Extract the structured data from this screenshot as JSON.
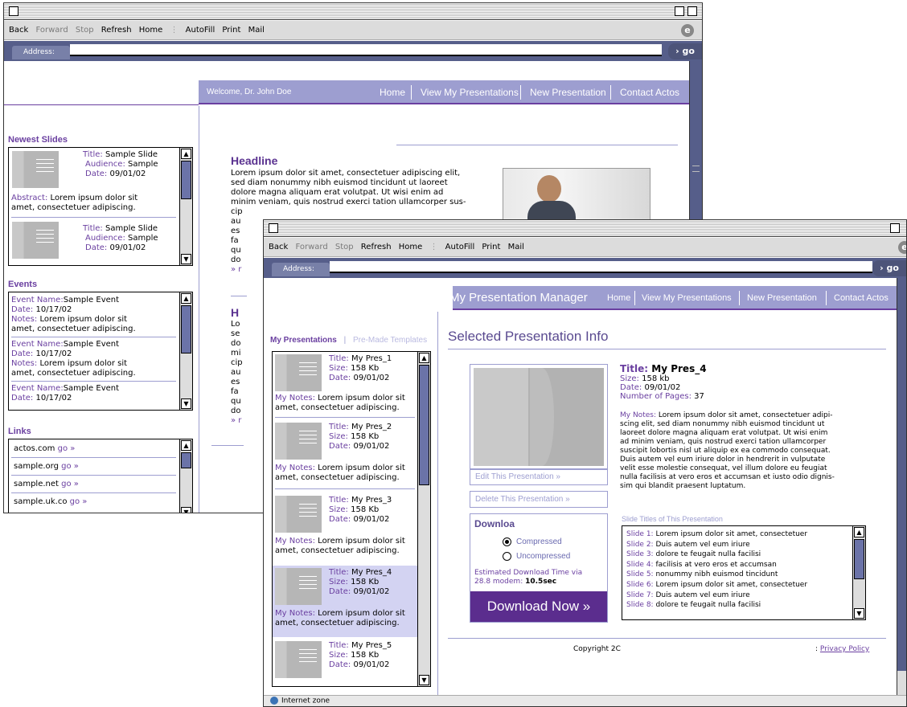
{
  "toolbar": {
    "back": "Back",
    "forward": "Forward",
    "stop": "Stop",
    "refresh": "Refresh",
    "home": "Home",
    "autofill": "AutoFill",
    "print": "Print",
    "mail": "Mail"
  },
  "address": {
    "label": "Address:",
    "go": "go",
    "logo": "e"
  },
  "nav": {
    "home": "Home",
    "view": "View My Presentations",
    "new": "New Presentation",
    "contact": "Contact Actos"
  },
  "w1": {
    "welcome": "Welcome, Dr. John Doe",
    "newest_title": "Newest Slides",
    "slides": [
      {
        "title_l": "Title:",
        "title": "Sample Slide",
        "aud_l": "Audience:",
        "aud": "Sample",
        "date_l": "Date:",
        "date": "09/01/02",
        "abs_l": "Abstract:",
        "abs1": "Lorem ipsum dolor sit",
        "abs2": "amet, consectetuer adipiscing."
      },
      {
        "title_l": "Title:",
        "title": "Sample Slide",
        "aud_l": "Audience:",
        "aud": "Sample",
        "date_l": "Date:",
        "date": "09/01/02"
      }
    ],
    "events_title": "Events",
    "events": [
      {
        "name_l": "Event Name:",
        "name": "Sample Event",
        "date_l": "Date:",
        "date": "10/17/02",
        "notes_l": "Notes:",
        "notes1": "Lorem ipsum dolor sit",
        "notes2": "amet, consectetuer adipiscing."
      },
      {
        "name_l": "Event Name:",
        "name": "Sample Event",
        "date_l": "Date:",
        "date": "10/17/02",
        "notes_l": "Notes:",
        "notes1": "Lorem ipsum dolor sit",
        "notes2": "amet, consectetuer adipiscing."
      },
      {
        "name_l": "Event Name:",
        "name": "Sample Event",
        "date_l": "Date:",
        "date": "10/17/02"
      }
    ],
    "links_title": "Links",
    "links": [
      {
        "site": "actos.com",
        "go": "go »"
      },
      {
        "site": "sample.org",
        "go": "go »"
      },
      {
        "site": "sample.net",
        "go": "go »"
      },
      {
        "site": "sample.uk.co",
        "go": "go »"
      }
    ],
    "headline": "Headline",
    "body": [
      "Lorem ipsum dolor sit amet, consectetuer adipiscing elit,",
      "sed diam nonummy nibh euismod tincidunt ut laoreet",
      "dolore magna aliquam erat volutpat. Ut wisi enim ad",
      "minim veniam, quis nostrud exerci tation ullamcorper sus-",
      "cip",
      "au",
      "es",
      "fa",
      "qu",
      "do",
      "» r"
    ],
    "headline2": "H",
    "body2": [
      "Lo",
      "se",
      "do",
      "mi",
      "cip",
      "au",
      "es",
      "fa",
      "qu",
      "do",
      "» r"
    ]
  },
  "w2": {
    "nav_title": "My Presentation Manager",
    "tab_my": "My Presentations",
    "tab_sep": "|",
    "tab_pre": "Pre-Made Templates",
    "presentations": [
      {
        "title": "My Pres_1",
        "size": "158 Kb",
        "date": "09/01/02"
      },
      {
        "title": "My Pres_2",
        "size": "158 Kb",
        "date": "09/01/02"
      },
      {
        "title": "My Pres_3",
        "size": "158 Kb",
        "date": "09/01/02"
      },
      {
        "title": "My Pres_4",
        "size": "158 Kb",
        "date": "09/01/02"
      },
      {
        "title": "My Pres_5",
        "size": "158 Kb",
        "date": "09/01/02"
      }
    ],
    "labels": {
      "title": "Title:",
      "size": "Size:",
      "date": "Date:",
      "notes": "My Notes:",
      "pages": "Number of Pages:"
    },
    "notes1": "Lorem ipsum dolor sit",
    "notes2": "amet, consectetuer adipiscing.",
    "selected_heading": "Selected Presentation Info",
    "sel": {
      "title": "My Pres_4",
      "size_l": "Size:",
      "size": "158 kb",
      "date": "09/01/02",
      "pages": "37"
    },
    "sel_notes": [
      "Lorem ipsum dolor sit amet, consectetuer adipi-",
      "scing elit, sed diam nonummy nibh euismod tincidunt ut",
      "laoreet dolore magna aliquam erat volutpat. Ut wisi enim",
      "ad minim veniam, quis nostrud exerci tation ullamcorper",
      "suscipit lobortis nisl ut aliquip ex ea commodo consequat.",
      "Duis autem vel eum iriure dolor in hendrerit in vulputate",
      "velit esse molestie consequat, vel illum dolore eu feugiat",
      "nulla facilisis at vero eros et accumsan et iusto odio dignis-",
      "sim qui blandit praesent luptatum."
    ],
    "edit": "Edit This Presentation »",
    "delete": "Delete This Presentation »",
    "download_title": "Downloa",
    "compressed": "Compressed",
    "uncompressed": "Uncompressed",
    "est1": "Estimated Download Time via",
    "est2": "28.8 modem:",
    "est_val": "10.5sec",
    "download_now": "Download Now »",
    "slide_titles_label": "Slide Titles of This Presentation",
    "slides": [
      {
        "n": "Slide 1:",
        "t": "Lorem ipsum dolor sit amet, consectetuer"
      },
      {
        "n": "Slide 2:",
        "t": "Duis autem vel eum iriure"
      },
      {
        "n": "Slide 3:",
        "t": "dolore te feugait nulla facilisi"
      },
      {
        "n": "Slide 4:",
        "t": "facilisis at vero eros et accumsan"
      },
      {
        "n": "Slide 5:",
        "t": "nonummy nibh euismod tincidunt"
      },
      {
        "n": "Slide 6:",
        "t": "Lorem ipsum dolor sit amet, consectetuer"
      },
      {
        "n": "Slide 7:",
        "t": "Duis autem vel eum iriure"
      },
      {
        "n": "Slide 8:",
        "t": "dolore te feugait nulla facilisi"
      }
    ],
    "copyright": "Copyright 2C",
    "privacy_pre": ":",
    "privacy": "Privacy Policy",
    "status": "Internet zone"
  }
}
